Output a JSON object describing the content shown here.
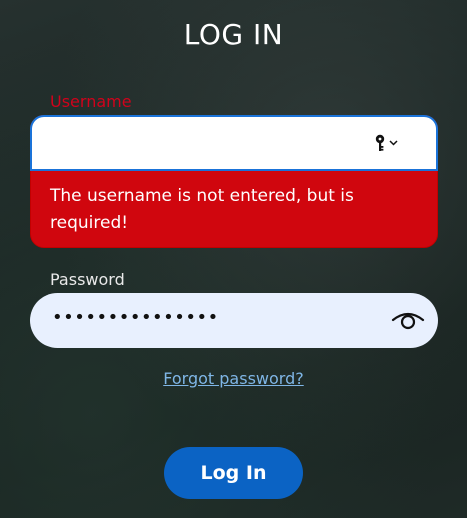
{
  "page": {
    "title": "LOG IN"
  },
  "username": {
    "label": "Username",
    "value": "",
    "error": "The username is not entered, but is required!"
  },
  "password": {
    "label": "Password",
    "masked_value": "•••••••••••••••"
  },
  "links": {
    "forgot_password": "Forgot password?"
  },
  "actions": {
    "login_label": "Log In"
  },
  "icons": {
    "key": "key-icon",
    "dropdown": "chevron-down-icon",
    "show_password": "eye-icon"
  },
  "colors": {
    "error_red": "#d0060e",
    "focus_blue": "#1a73d9",
    "primary_button": "#0b63c4",
    "link": "#7fb6e6"
  }
}
